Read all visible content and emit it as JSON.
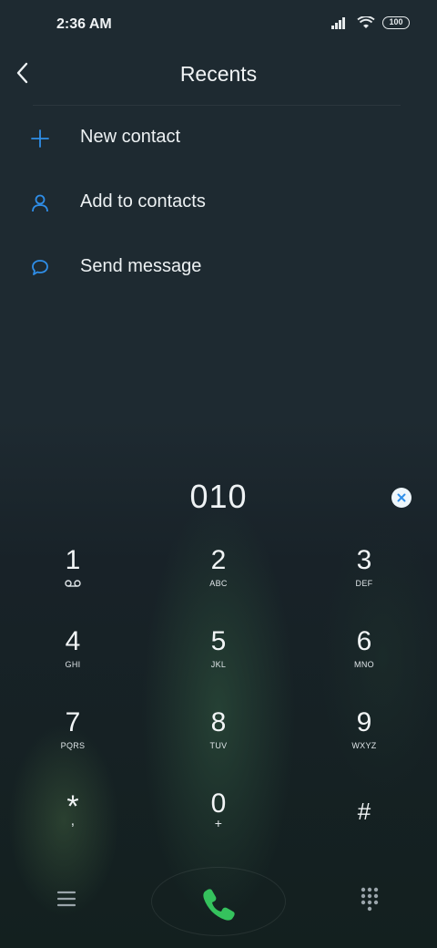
{
  "status_bar": {
    "time": "2:36 AM",
    "battery": "100",
    "icons": [
      "signal-icon",
      "wifi-icon",
      "battery-icon"
    ]
  },
  "header": {
    "title": "Recents",
    "back_icon": "back-arrow-icon"
  },
  "menu": [
    {
      "label": "New contact",
      "icon": "plus-icon"
    },
    {
      "label": "Add to contacts",
      "icon": "person-icon"
    },
    {
      "label": "Send message",
      "icon": "message-icon"
    }
  ],
  "dialer": {
    "number": "010",
    "clear_icon": "clear-icon",
    "keys": [
      {
        "digit": "1",
        "letters": "voicemail"
      },
      {
        "digit": "2",
        "letters": "ABC"
      },
      {
        "digit": "3",
        "letters": "DEF"
      },
      {
        "digit": "4",
        "letters": "GHI"
      },
      {
        "digit": "5",
        "letters": "JKL"
      },
      {
        "digit": "6",
        "letters": "MNO"
      },
      {
        "digit": "7",
        "letters": "PQRS"
      },
      {
        "digit": "8",
        "letters": "TUV"
      },
      {
        "digit": "9",
        "letters": "WXYZ"
      },
      {
        "digit": "*",
        "letters": ","
      },
      {
        "digit": "0",
        "letters": "+"
      },
      {
        "digit": "#",
        "letters": ""
      }
    ]
  },
  "bottom_bar": {
    "menu_icon": "hamburger-icon",
    "call_icon": "phone-icon",
    "dialpad_icon": "dialpad-icon"
  },
  "colors": {
    "accent": "#2f8ee8",
    "call_green": "#35c25d",
    "background": "#1d2830"
  }
}
